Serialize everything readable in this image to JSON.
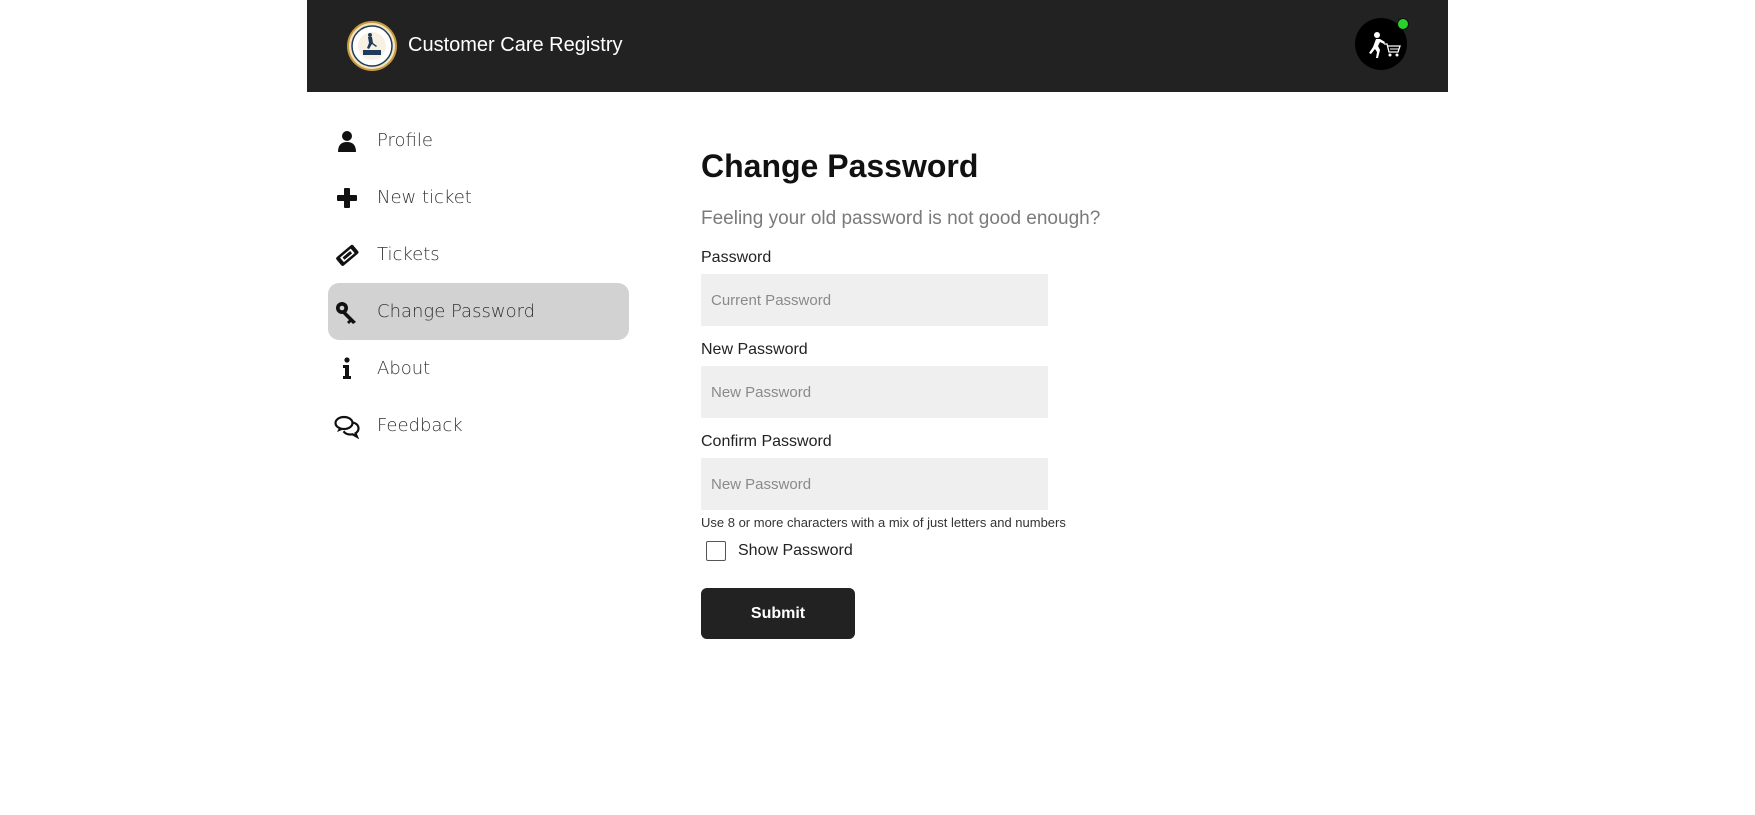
{
  "header": {
    "app_title": "Customer Care Registry",
    "logo_icon": "customer-care-logo",
    "avatar_icon": "person-pushing-cart-icon",
    "online_color": "#2ad12a",
    "background_color": "#222222"
  },
  "sidebar": {
    "items": [
      {
        "label": "Profile",
        "icon": "user-icon",
        "active": false
      },
      {
        "label": "New ticket",
        "icon": "plus-icon",
        "active": false
      },
      {
        "label": "Tickets",
        "icon": "ticket-icon",
        "active": false
      },
      {
        "label": "Change Password",
        "icon": "key-icon",
        "active": true
      },
      {
        "label": "About",
        "icon": "info-icon",
        "active": false
      },
      {
        "label": "Feedback",
        "icon": "comments-icon",
        "active": false
      }
    ],
    "active_color": "#d2d2d2"
  },
  "main": {
    "title": "Change Password",
    "subtitle": "Feeling your old password is not good enough?",
    "fields": [
      {
        "label": "Password",
        "placeholder": "Current Password",
        "value": ""
      },
      {
        "label": "New Password",
        "placeholder": "New Password",
        "value": ""
      },
      {
        "label": "Confirm Password",
        "placeholder": "New Password",
        "value": ""
      }
    ],
    "hint": "Use 8 or more characters with a mix of just letters and numbers",
    "show_password_label": "Show Password",
    "show_password_checked": false,
    "submit_label": "Submit"
  }
}
